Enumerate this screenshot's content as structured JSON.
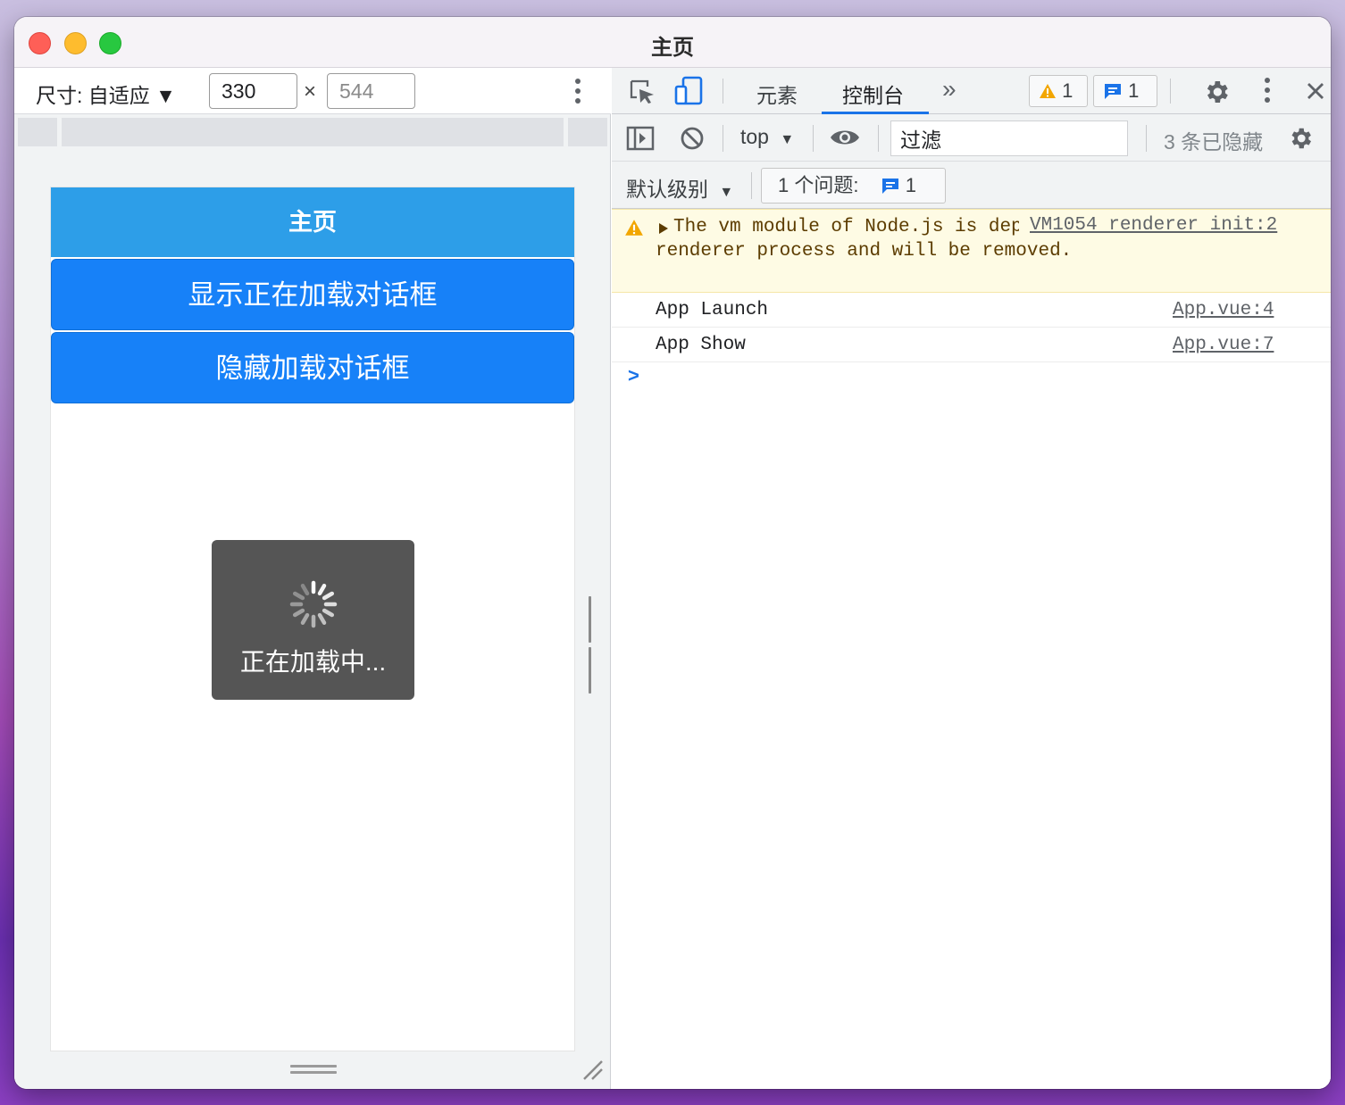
{
  "window": {
    "title": "主页"
  },
  "device_toolbar": {
    "dimensions_label": "尺寸: 自适应 ▼",
    "width_value": "330",
    "height_value": "544",
    "times_symbol": "×"
  },
  "device_page": {
    "nav_title": "主页",
    "show_loading_button": "显示正在加载对话框",
    "hide_loading_button": "隐藏加载对话框",
    "loading_text": "正在加载中..."
  },
  "devtools": {
    "tabs": [
      {
        "label": "元素",
        "active": false
      },
      {
        "label": "控制台",
        "active": true
      }
    ],
    "more_tabs_icon": "»",
    "warning_count": "1",
    "message_count": "1",
    "context_selector": "top",
    "filter_value": "过滤",
    "hidden_count_text": "3 条已隐藏",
    "level_selector": "默认级别",
    "issues_label": "1 个问题:",
    "issues_count": "1",
    "messages": [
      {
        "type": "warning",
        "text": "The vm module of Node.js is deprecated in the renderer process and will be removed.",
        "source": "VM1054 renderer init:2"
      },
      {
        "type": "log",
        "text": "App Launch",
        "source": "App.vue:4"
      },
      {
        "type": "log",
        "text": "App Show",
        "source": "App.vue:7"
      }
    ],
    "prompt_symbol": ">"
  },
  "colors": {
    "nav_bar": "#2d9ee8",
    "primary_button": "#1781f8",
    "toast_background": "#555555",
    "active_tab_underline": "#1a73e8",
    "warning_background": "#fefbe4"
  }
}
